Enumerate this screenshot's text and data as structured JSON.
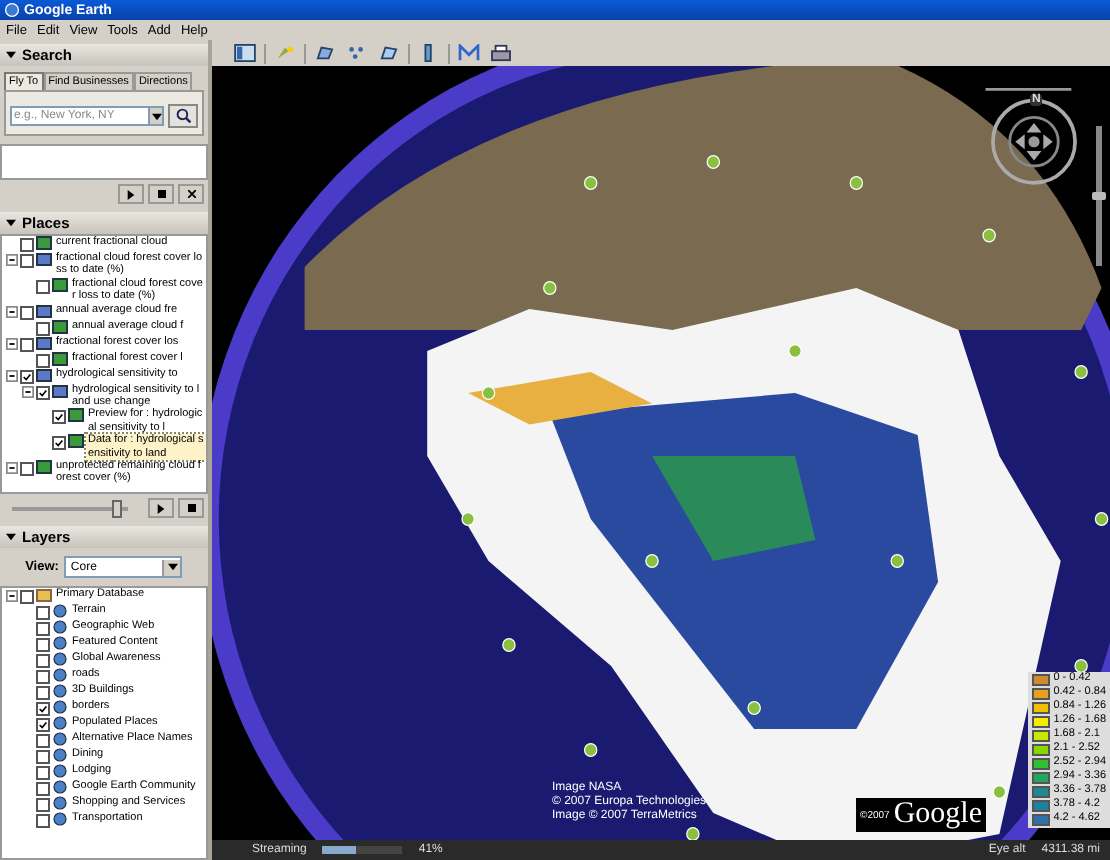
{
  "window": {
    "title": "Google Earth"
  },
  "menu": [
    "File",
    "Edit",
    "View",
    "Tools",
    "Add",
    "Help"
  ],
  "search": {
    "title": "Search",
    "expanded": true,
    "tabs": [
      {
        "label": "Fly To",
        "selected": true
      },
      {
        "label": "Find Businesses",
        "selected": false
      },
      {
        "label": "Directions",
        "selected": false
      }
    ],
    "placeholder": "e.g., New York, NY"
  },
  "places": {
    "title": "Places",
    "expanded": true,
    "items": [
      {
        "label": "current fractional cloud",
        "checked": false,
        "selected": false
      },
      {
        "label": "fractional cloud forest cover loss to date (%)",
        "checked": false,
        "selected": false,
        "expanded": true,
        "children": [
          {
            "label": "fractional cloud forest cover loss to date (%)",
            "checked": false,
            "selected": false
          }
        ]
      },
      {
        "label": "annual average cloud fre",
        "checked": false,
        "selected": false,
        "expanded": true,
        "children": [
          {
            "label": "annual average cloud f",
            "checked": false,
            "selected": false
          }
        ]
      },
      {
        "label": "fractional forest cover los",
        "checked": false,
        "selected": false,
        "expanded": true,
        "children": [
          {
            "label": "fractional forest cover l",
            "checked": false,
            "selected": false
          }
        ]
      },
      {
        "label": "hydrological sensitivity to",
        "checked": true,
        "selected": false,
        "expanded": true,
        "children": [
          {
            "label": "hydrological sensitivity to land use change",
            "checked": true,
            "selected": false,
            "expanded": true,
            "children": [
              {
                "label": "Preview for : hydrological sensitivity to l",
                "checked": true,
                "selected": false
              },
              {
                "label": "Data for : hydrological sensitivity to land",
                "checked": true,
                "selected": true
              }
            ]
          }
        ]
      },
      {
        "label": "unprotected remaining cloud forest cover (%)",
        "checked": false,
        "selected": false,
        "expanded": true
      }
    ],
    "level": 0.95
  },
  "layers": {
    "title": "Layers",
    "expanded": true,
    "view_label": "View:",
    "view": "Core",
    "items": [
      {
        "label": "Primary Database",
        "checked": false,
        "selected": false,
        "expanded": true,
        "children": [
          {
            "label": "Terrain",
            "checked": false,
            "selected": false
          },
          {
            "label": "Geographic Web",
            "checked": false,
            "selected": false
          },
          {
            "label": "Featured Content",
            "checked": false,
            "selected": false
          },
          {
            "label": "Global Awareness",
            "checked": false,
            "selected": false
          },
          {
            "label": "roads",
            "checked": false,
            "selected": false
          },
          {
            "label": "3D Buildings",
            "checked": false,
            "selected": false
          },
          {
            "label": "borders",
            "checked": true,
            "selected": false
          },
          {
            "label": "Populated Places",
            "checked": true,
            "selected": false
          },
          {
            "label": "Alternative Place Names",
            "checked": false,
            "selected": false
          },
          {
            "label": "Dining",
            "checked": false,
            "selected": false
          },
          {
            "label": "Lodging",
            "checked": false,
            "selected": false
          },
          {
            "label": "Google Earth Community",
            "checked": false,
            "selected": false
          },
          {
            "label": "Shopping and Services",
            "checked": false,
            "selected": false
          },
          {
            "label": "Transportation",
            "checked": false,
            "selected": false
          }
        ]
      }
    ]
  },
  "map": {
    "compass_label": "N",
    "zoom": {
      "level": 0.5
    },
    "attribution": [
      "Image NASA",
      "© 2007 Europa Technologies",
      "Image © 2007 TerraMetrics"
    ],
    "logo_copyright": "©2007",
    "logo": "Google",
    "legend": [
      {
        "label": "0 - 0.42",
        "color": "#d08a30"
      },
      {
        "label": "0.42 - 0.84",
        "color": "#e8a020"
      },
      {
        "label": "0.84 - 1.26",
        "color": "#f0c000"
      },
      {
        "label": "1.26 - 1.68",
        "color": "#f0f000"
      },
      {
        "label": "1.68 - 2.1",
        "color": "#c8e800"
      },
      {
        "label": "2.1 - 2.52",
        "color": "#88d800"
      },
      {
        "label": "2.52 - 2.94",
        "color": "#30c030"
      },
      {
        "label": "2.94 - 3.36",
        "color": "#20a860"
      },
      {
        "label": "3.36 - 3.78",
        "color": "#208890"
      },
      {
        "label": "3.78 - 4.2",
        "color": "#2080a0"
      },
      {
        "label": "4.2 - 4.62",
        "color": "#3070a8"
      }
    ]
  },
  "status_bar": {
    "streaming_label": "Streaming",
    "level": 0.41,
    "percent": "41%",
    "eye_alt_label": "Eye alt",
    "eye_alt": "4311.38 mi"
  }
}
